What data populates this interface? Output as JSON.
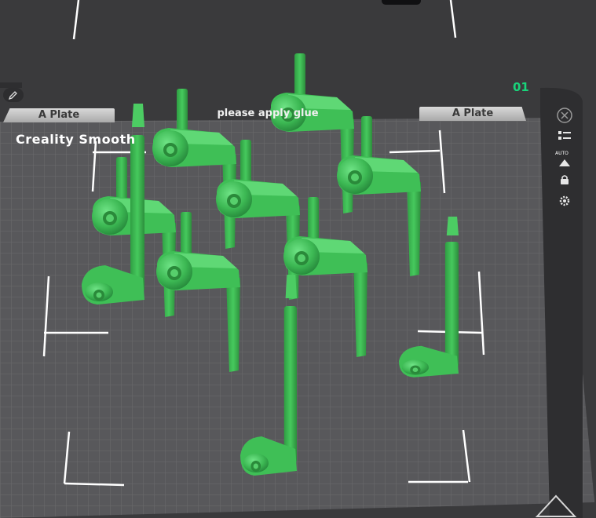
{
  "plate": {
    "name": "Creality Smooth",
    "index": "01",
    "left_tab_label": "A Plate",
    "right_tab_label": "A Plate",
    "center_label": "please apply glue"
  },
  "side_toolbar": {
    "auto_label": "AUTO",
    "icons": [
      "close-icon",
      "list-icon",
      "auto-arrange-icon",
      "lock-icon",
      "gear-icon"
    ]
  },
  "colors": {
    "model_green": "#3ec155",
    "plate_grid": "#5a5a5e",
    "accent_green": "#19d37a"
  }
}
